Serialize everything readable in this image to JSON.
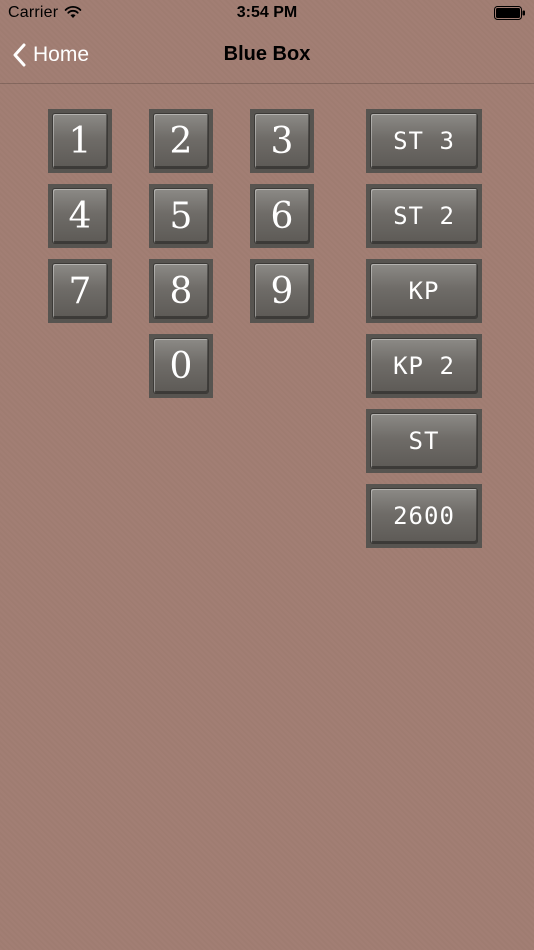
{
  "status_bar": {
    "carrier": "Carrier",
    "time": "3:54 PM",
    "icons": [
      "wifi-icon",
      "battery-icon"
    ]
  },
  "nav": {
    "back_label": "Home",
    "title": "Blue Box"
  },
  "digits": [
    "1",
    "2",
    "3",
    "4",
    "5",
    "6",
    "7",
    "8",
    "9",
    "0"
  ],
  "functions": [
    "ST 3",
    "ST 2",
    "KP",
    "KP 2",
    "ST",
    "2600"
  ],
  "colors": {
    "background": "#a17d72",
    "key_frame": "#575450",
    "key_face": "#6f6c68",
    "key_text": "#ffffff"
  }
}
